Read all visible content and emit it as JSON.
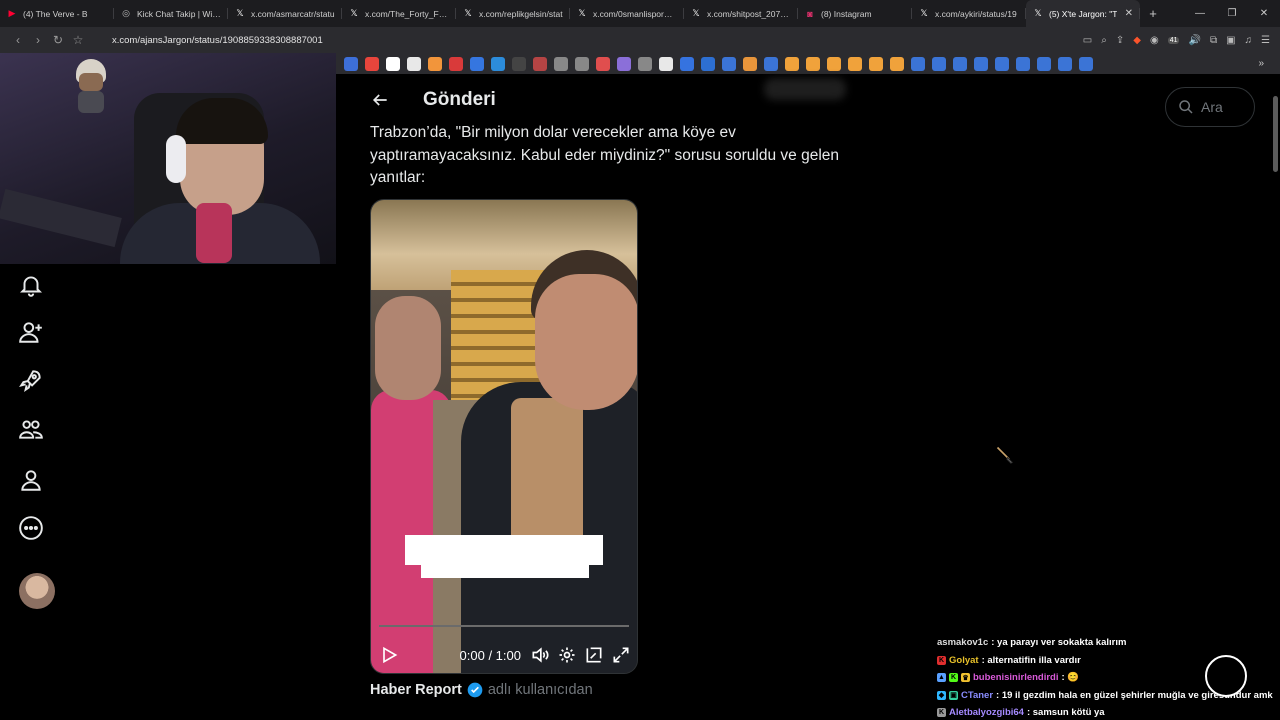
{
  "browser": {
    "tabs": [
      {
        "title": "(4) The Verve - B",
        "icon": "youtube-icon",
        "color": "#ff0033",
        "glyph": "▶"
      },
      {
        "title": "Kick Chat Takip | Wich",
        "icon": "globe-icon",
        "color": "#bbbbbb",
        "glyph": "◎"
      },
      {
        "title": "x.com/asmarcatr/statu",
        "icon": "x-logo-icon",
        "color": "#ffffff",
        "glyph": "𝕏"
      },
      {
        "title": "x.com/The_Forty_Four",
        "icon": "x-logo-icon",
        "color": "#ffffff",
        "glyph": "𝕏"
      },
      {
        "title": "x.com/replikgelsin/stat",
        "icon": "x-logo-icon",
        "color": "#ffffff",
        "glyph": "𝕏"
      },
      {
        "title": "x.com/0smanlisporFK/",
        "icon": "x-logo-icon",
        "color": "#ffffff",
        "glyph": "𝕏"
      },
      {
        "title": "x.com/shitpost_2077/s",
        "icon": "x-logo-icon",
        "color": "#ffffff",
        "glyph": "𝕏"
      },
      {
        "title": "(8) Instagram",
        "icon": "instagram-icon",
        "color": "#e1306c",
        "glyph": "◙"
      },
      {
        "title": "x.com/aykiri/status/19",
        "icon": "x-logo-icon",
        "color": "#ffffff",
        "glyph": "𝕏"
      },
      {
        "title": "(5) X'te Jargon: \"T",
        "icon": "x-logo-icon",
        "color": "#ffffff",
        "glyph": "𝕏",
        "active": true
      }
    ],
    "url": "x.com/ajansJargon/status/1908859338308887001",
    "brave_color": "#fb542b",
    "badge_count": "41"
  },
  "nav": {
    "title": "Gönderi",
    "back_label": "Geri"
  },
  "post": {
    "text": "Trabzon’da, \"Bir milyon dolar verecekler ama köye ev yaptıramayacaksınız. Kabul eder miydiniz?\" sorusu soruldu ve gelen yanıtlar:",
    "video": {
      "time": "0:00 / 1:00",
      "progress": 0
    },
    "source_name": "Haber Report",
    "source_suffix": "adlı kullanıcıdan",
    "verified_color": "#1d9bf0"
  },
  "search": {
    "placeholder": "Ara"
  },
  "rail_items": [
    "notifications-icon",
    "follow-icon",
    "rocket-icon",
    "communities-icon",
    "profile-icon",
    "more-icon"
  ],
  "chat": [
    {
      "user": "asmakov1c",
      "text": ": ya parayı ver sokakta kalırım",
      "color": "#dddddd",
      "badges": []
    },
    {
      "user": "Golyat",
      "text": ": alternatifin illa vardır",
      "color": "#e8c12a",
      "badges": [
        {
          "glyph": "K",
          "color": "#e02e2e"
        }
      ]
    },
    {
      "user": "bubenisinirlendirdi",
      "text": ": 😊",
      "color": "#d85ad8",
      "badges": [
        {
          "glyph": "▲",
          "color": "#5aa0ff"
        },
        {
          "glyph": "K",
          "color": "#53fc18"
        },
        {
          "glyph": "♛",
          "color": "#f2c230"
        }
      ]
    },
    {
      "user": "CTaner",
      "text": ": 19 il gezdim hala en güzel şehirler muğla ve giresundur amk",
      "color": "#8a8dff",
      "badges": [
        {
          "glyph": "◆",
          "color": "#2fb7ff"
        },
        {
          "glyph": "▣",
          "color": "#35d0a0"
        }
      ]
    },
    {
      "user": "Aletbalyozgibi64",
      "text": ": samsun kötü ya",
      "color": "#a58aff",
      "badges": [
        {
          "glyph": "K",
          "color": "#999999"
        }
      ]
    }
  ]
}
